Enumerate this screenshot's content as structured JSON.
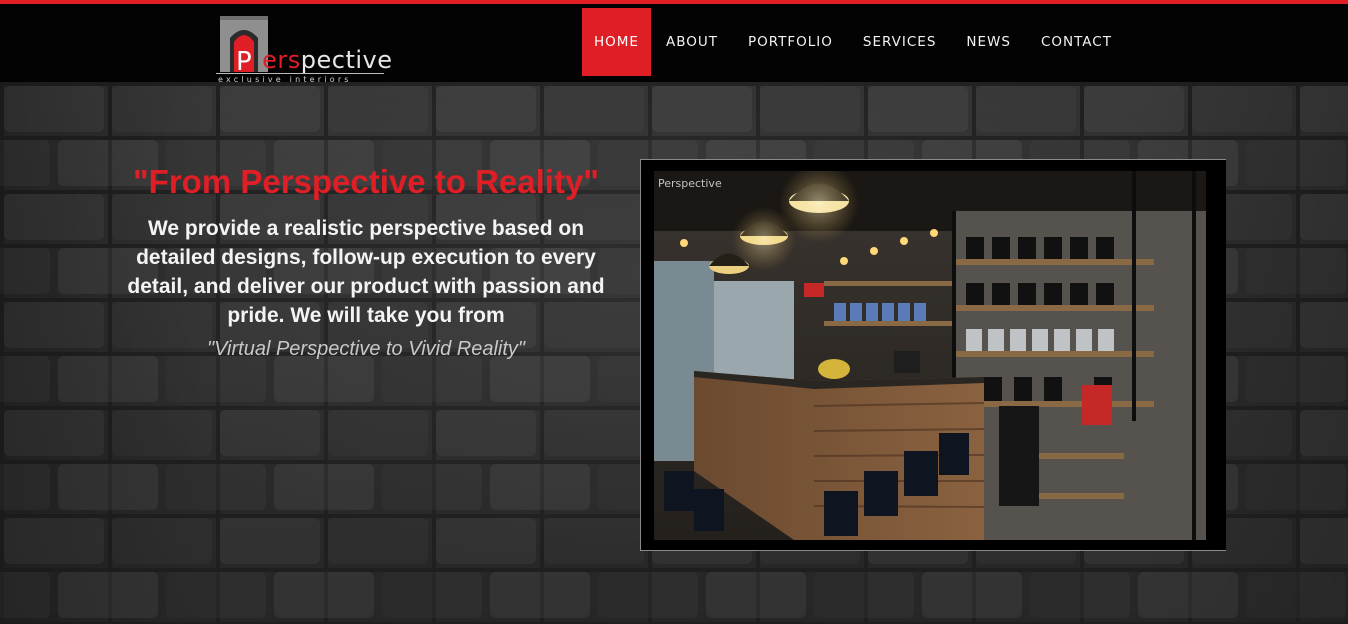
{
  "brand": {
    "name_initial": "P",
    "name_red": "ers",
    "name_rest": "pective",
    "tagline": "exclusive interiors",
    "accent_color": "#e01e26"
  },
  "nav": {
    "items": [
      {
        "label": "HOME",
        "active": true
      },
      {
        "label": "ABOUT",
        "active": false
      },
      {
        "label": "PORTFOLIO",
        "active": false
      },
      {
        "label": "SERVICES",
        "active": false
      },
      {
        "label": "NEWS",
        "active": false
      },
      {
        "label": "CONTACT",
        "active": false
      }
    ]
  },
  "hero": {
    "title": "\"From Perspective to Reality\"",
    "body": "We provide a realistic perspective based on detailed designs, follow-up execution to every detail, and deliver our product with passion and pride. We will take you from",
    "quote": "\"Virtual Perspective to Vivid Reality\""
  },
  "photo": {
    "subject": "supplement-store-interior",
    "watermark": "Perspective"
  }
}
